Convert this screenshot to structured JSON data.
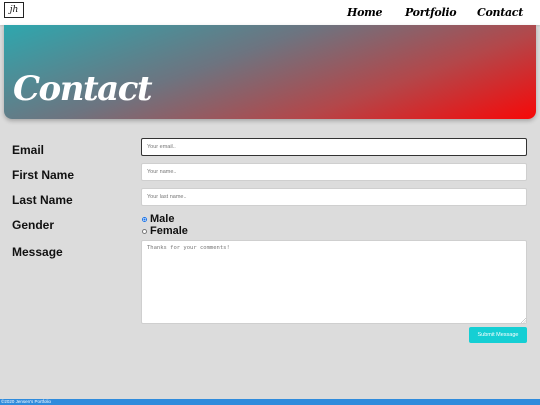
{
  "nav": {
    "logo": "jh",
    "links": [
      "Home",
      "Portfolio",
      "Contact"
    ]
  },
  "hero": {
    "title": "Contact"
  },
  "form": {
    "email": {
      "label": "Email",
      "placeholder": "Your email..",
      "value": ""
    },
    "first_name": {
      "label": "First Name",
      "placeholder": "Your name..",
      "value": ""
    },
    "last_name": {
      "label": "Last Name",
      "placeholder": "Your last name..",
      "value": ""
    },
    "gender": {
      "label": "Gender",
      "options": [
        "Male",
        "Female"
      ],
      "selected": "Male"
    },
    "message": {
      "label": "Message",
      "placeholder": "Thanks for your comments!",
      "value": ""
    },
    "submit_label": "Submit Message"
  },
  "footer": {
    "text": "©2020 Jensen's Portfolio"
  },
  "colors": {
    "accent": "#15cfd4",
    "footer": "#2f8bdc",
    "hero_start": "#2ea7ae",
    "hero_end": "#f70808"
  }
}
